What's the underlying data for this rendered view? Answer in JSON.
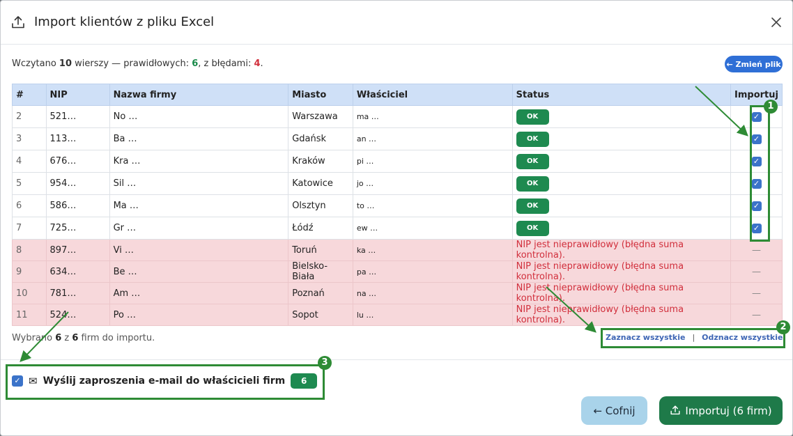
{
  "dialog": {
    "title": "Import klientów z pliku Excel",
    "icons": {
      "title": "upload-icon",
      "close": "close-icon"
    }
  },
  "summary": {
    "prefix": "Wczytano ",
    "total": "10",
    "middle": " wierszy — prawidłowych: ",
    "valid": "6",
    "sep": ", z błędami: ",
    "errors": "4",
    "suffix": "."
  },
  "change_file_label": "← Zmień plik",
  "table": {
    "headers": [
      "#",
      "NIP",
      "Nazwa firmy",
      "Miasto",
      "Właściciel",
      "Status",
      "Importuj"
    ],
    "rows": [
      {
        "n": "2",
        "nip": "521…",
        "name": "No  …",
        "city": "Warszawa",
        "owner": "ma  …",
        "status": "OK",
        "ok": true
      },
      {
        "n": "3",
        "nip": "113…",
        "name": "Ba  …",
        "city": "Gdańsk",
        "owner": "an  …",
        "status": "OK",
        "ok": true
      },
      {
        "n": "4",
        "nip": "676…",
        "name": "Kra  …",
        "city": "Kraków",
        "owner": "pi  …",
        "status": "OK",
        "ok": true
      },
      {
        "n": "5",
        "nip": "954…",
        "name": "Sil  …",
        "city": "Katowice",
        "owner": "jo  …",
        "status": "OK",
        "ok": true
      },
      {
        "n": "6",
        "nip": "586…",
        "name": "Ma  …",
        "city": "Olsztyn",
        "owner": "to  …",
        "status": "OK",
        "ok": true
      },
      {
        "n": "7",
        "nip": "725…",
        "name": "Gr  …",
        "city": "Łódź",
        "owner": "ew  …",
        "status": "OK",
        "ok": true
      },
      {
        "n": "8",
        "nip": "897…",
        "name": "Vi  …",
        "city": "Toruń",
        "owner": "ka  …",
        "status": "NIP jest nieprawidłowy (błędna suma kontrolna).",
        "ok": false
      },
      {
        "n": "9",
        "nip": "634…",
        "name": "Be  …",
        "city": "Bielsko-Biała",
        "owner": "pa  …",
        "status": "NIP jest nieprawidłowy (błędna suma kontrolna).",
        "ok": false
      },
      {
        "n": "10",
        "nip": "781…",
        "name": "Am  …",
        "city": "Poznań",
        "owner": "na  …",
        "status": "NIP jest nieprawidłowy (błędna suma kontrolna).",
        "ok": false
      },
      {
        "n": "11",
        "nip": "524…",
        "name": "Po  …",
        "city": "Sopot",
        "owner": "lu  …",
        "status": "NIP jest nieprawidłowy (błędna suma kontrolna).",
        "ok": false
      }
    ],
    "checkmark": "✓",
    "dash": "—"
  },
  "selection": {
    "prefix": "Wybrano ",
    "selected": "6",
    "mid": " z ",
    "total": "6",
    "suffix": " firm do importu.",
    "select_all": "Zaznacz wszystkie",
    "divider": "|",
    "deselect_all": "Odznacz wszystkie"
  },
  "invite": {
    "label": "Wyślij zaproszenia e-mail do właścicieli firm",
    "count": "6",
    "checked": true,
    "icon": "mail-icon",
    "mail_glyph": "✉"
  },
  "buttons": {
    "back": "← Cofnij",
    "import": "Importuj (6 firm)"
  },
  "annotations": [
    "1",
    "2",
    "3"
  ],
  "colors": {
    "accent": "#2f6fd6",
    "ok": "#1e8a50",
    "error": "#d12f3c",
    "error_row": "#f7d8db",
    "annotation": "#2e8b35",
    "header": "#cfe0f7"
  }
}
